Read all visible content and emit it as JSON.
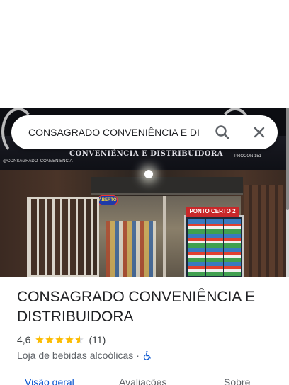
{
  "search": {
    "value": "CONSAGRADO CONVENIÊNCIA E DI"
  },
  "photo": {
    "sign_main": "CONVENIÊNCIA E DISTRIBUIDORA",
    "sign_instagram": "@CONSAGRADO_CONVENIENCIA",
    "sign_procon": "PROCON 151",
    "open_sign": "ABERTO",
    "fridge_sign": "PONTO CERTO 2"
  },
  "place": {
    "title": "CONSAGRADO CONVENIÊNCIA E DISTRIBUIDORA",
    "rating": "4,6",
    "rating_stars": 4.6,
    "reviews_count": "(11)",
    "category": "Loja de bebidas alcoólicas",
    "separator": "·",
    "accessibility_icon": "wheelchair-icon"
  },
  "tabs": [
    {
      "label": "Visão geral",
      "active": true
    },
    {
      "label": "Avaliações",
      "active": false
    },
    {
      "label": "Sobre",
      "active": false
    }
  ],
  "colors": {
    "accent": "#0b57d0",
    "star": "#fbbc04",
    "text": "#202124",
    "muted": "#5f6368"
  }
}
